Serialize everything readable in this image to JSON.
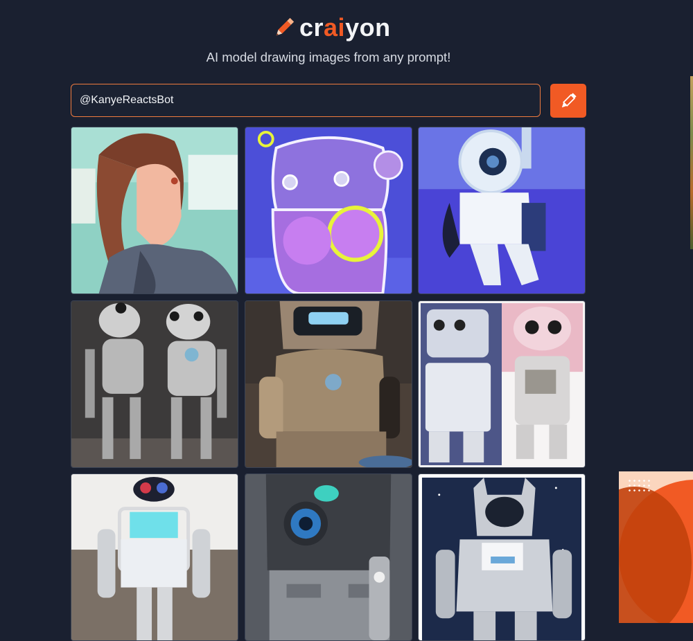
{
  "header": {
    "logo_text_pre": "cr",
    "logo_text_ai": "ai",
    "logo_text_post": "yon",
    "tagline": "AI model drawing images from any prompt!"
  },
  "search": {
    "prompt_value": "@KanyeReactsBot",
    "draw_icon": "pencil-icon"
  },
  "gallery": {
    "images": [
      "generated-image-1",
      "generated-image-2",
      "generated-image-3",
      "generated-image-4",
      "generated-image-5",
      "generated-image-6",
      "generated-image-7",
      "generated-image-8",
      "generated-image-9"
    ]
  },
  "colors": {
    "background": "#1a2030",
    "accent": "#f15a24",
    "text": "#f3f4f6"
  }
}
